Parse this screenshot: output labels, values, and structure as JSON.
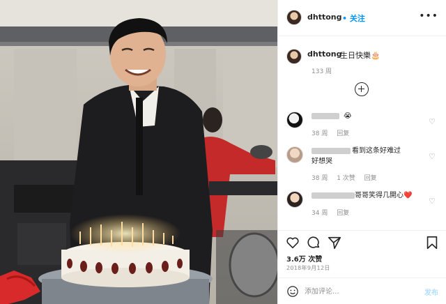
{
  "post": {
    "username": "dhttong",
    "follow_label": "• 关注",
    "more_label": "•••"
  },
  "caption": {
    "username": "dhttong",
    "text": "生日快樂🎂",
    "time": "133 周"
  },
  "comments": [
    {
      "text": "😭",
      "time": "38 周",
      "reply": "回复"
    },
    {
      "text": "看到这条好难过好想哭",
      "time": "38 周",
      "likes": "1 次赞",
      "reply": "回复"
    },
    {
      "text": "哥哥笑得几開心❤️",
      "time": "34 周",
      "reply": "回复"
    }
  ],
  "actions": {
    "likes": "3.6万 次赞",
    "date": "2018年9月12日"
  },
  "add_comment": {
    "placeholder": "添加评论...",
    "post_label": "发布"
  }
}
